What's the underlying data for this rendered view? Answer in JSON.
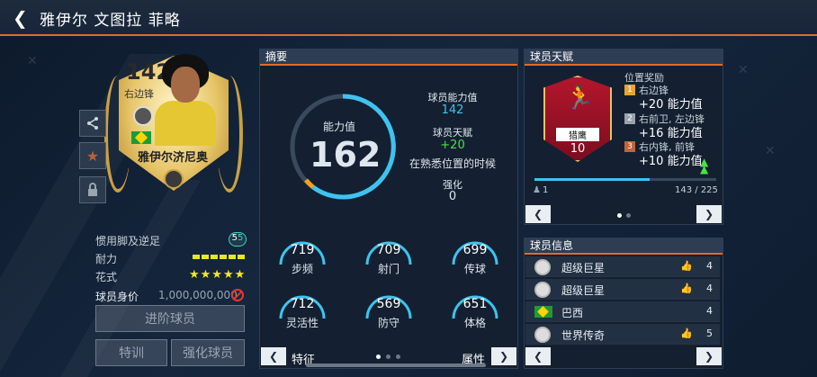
{
  "header": {
    "back_icon": "chevron-left-icon",
    "title": "雅伊尔 文图拉 菲略"
  },
  "card": {
    "rating": "142",
    "position": "右边锋",
    "name": "雅伊尔济尼奥"
  },
  "left_stats": {
    "foot_label": "惯用脚及逆足",
    "foot_value_a": "5",
    "foot_value_b": "5",
    "stamina_label": "耐力",
    "skill_label": "花式",
    "skill_stars": "★★★★★",
    "price_label": "球员身价",
    "price_value": "1,000,000,000"
  },
  "buttons": {
    "advance": "进阶球员",
    "special_training": "特训",
    "enhance": "强化球员"
  },
  "summary": {
    "title": "摘要",
    "ovr_label": "能力值",
    "ovr_value": "162",
    "ability_label": "球员能力值",
    "ability_value": "142",
    "talent_label": "球员天赋",
    "talent_value": "+20",
    "talent_note": "在熟悉位置的时候",
    "enhance_label": "强化",
    "enhance_value": "0",
    "stats": [
      {
        "label": "步频",
        "value": "719"
      },
      {
        "label": "射门",
        "value": "709"
      },
      {
        "label": "传球",
        "value": "699"
      },
      {
        "label": "灵活性",
        "value": "712"
      },
      {
        "label": "防守",
        "value": "569"
      },
      {
        "label": "体格",
        "value": "651"
      }
    ],
    "footer_left": "特征",
    "footer_right": "属性"
  },
  "talent": {
    "title": "球员天赋",
    "badge_name": "猎鹰",
    "badge_level": "10",
    "bonus_title": "位置奖励",
    "rows": [
      {
        "num": "1",
        "positions": "右边锋",
        "bonus": "+20 能力值",
        "color": "#e8a33a"
      },
      {
        "num": "2",
        "positions": "右前卫, 左边锋",
        "bonus": "+16 能力值",
        "color": "#9aa3ad"
      },
      {
        "num": "3",
        "positions": "右内锋, 前锋",
        "bonus": "+10 能力值",
        "color": "#c0653a"
      }
    ],
    "progress_count": "1",
    "progress_text": "143 / 225",
    "progress_fraction": 0.636
  },
  "player_info": {
    "title": "球员信息",
    "rows": [
      {
        "text": "超级巨星",
        "value": "4"
      },
      {
        "text": "超级巨星",
        "value": "4"
      },
      {
        "text": "巴西",
        "value": "4"
      },
      {
        "text": "世界传奇",
        "value": "5"
      }
    ]
  },
  "colors": {
    "accent": "#e46a2a",
    "cyan": "#3ec3f0",
    "green": "#4ae04a",
    "gauge_orange": "#f0a020"
  }
}
